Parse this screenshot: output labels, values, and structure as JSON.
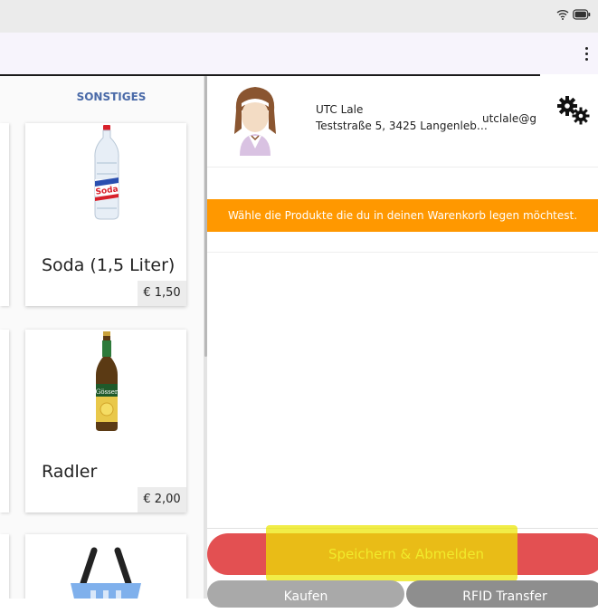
{
  "toolbar": {
    "menu_icon": "more-vert-icon"
  },
  "status_bar": {
    "icons": [
      "wifi-icon",
      "battery-icon"
    ]
  },
  "category": {
    "title": "SONSTIGES"
  },
  "products": [
    {
      "name": "Soda (1,5 Liter)",
      "price": "€ 1,50",
      "image": "soda-bottle-image"
    },
    {
      "name": "Radler",
      "price": "€ 2,00",
      "image": "beer-bottle-image"
    },
    {
      "name": "",
      "price": "",
      "image": "shopping-basket-image"
    }
  ],
  "customer": {
    "name": "UTC Lale",
    "address": "Teststraße 5, 3425 Langenleb…",
    "email": "utclale@gr",
    "avatar": "avatar-image"
  },
  "settings_icon": "gears-icon",
  "info_banner": {
    "text": "Wähle die Produkte die du in deinen Warenkorb legen möchtest."
  },
  "actions": {
    "save_logout": "Speichern & Abmelden",
    "bottom_left": "Kaufen",
    "bottom_right": "RFID Transfer"
  },
  "colors": {
    "banner": "#ff9800",
    "save_button": "#e35052",
    "save_text": "#fdf39a",
    "highlight": "#ebe600",
    "category_title": "#4a6aa8"
  }
}
